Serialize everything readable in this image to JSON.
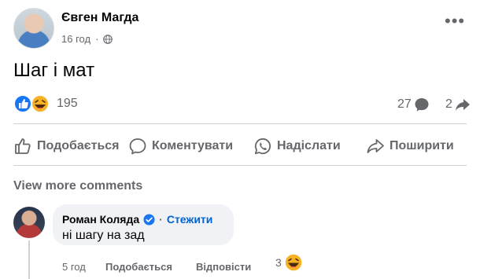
{
  "post": {
    "author": "Євген Магда",
    "time": "16 год",
    "text": "Шаг і мат",
    "reactions_count": "195",
    "comments_count": "27",
    "shares_count": "2",
    "reaction_icons": [
      "like-icon",
      "haha-icon"
    ]
  },
  "actions": {
    "like": "Подобається",
    "comment": "Коментувати",
    "send": "Надіслати",
    "share": "Поширити"
  },
  "comments": {
    "view_more": "View more comments",
    "items": [
      {
        "author": "Роман Коляда",
        "verified": true,
        "follow_label": "Стежити",
        "text": "ні шагу на зад",
        "time": "5 год",
        "like_label": "Подобається",
        "reply_label": "Відповісти",
        "reaction_count": "3",
        "reaction_icon": "haha-icon"
      }
    ]
  },
  "colors": {
    "like_blue": "#1877f2",
    "link_blue": "#0064d1",
    "secondary_text": "#65676b",
    "bubble_bg": "#f0f2f5",
    "haha_yellow": "#f7b125"
  }
}
